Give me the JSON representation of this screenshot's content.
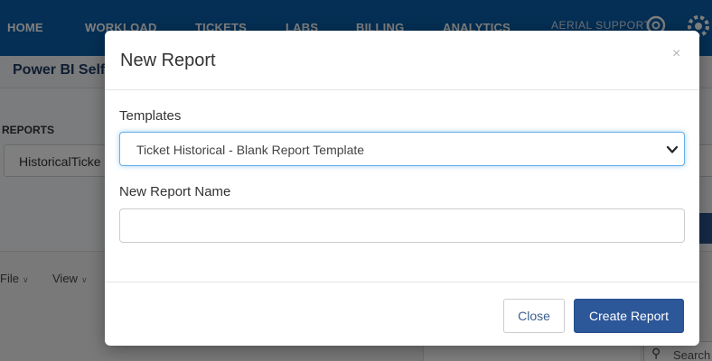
{
  "nav": {
    "items": [
      "HOME",
      "WORKLOAD",
      "TICKETS",
      "LABS",
      "BILLING",
      "ANALYTICS"
    ],
    "brand": "AERIAL SUPPORT"
  },
  "page": {
    "title": "Power BI Self",
    "reports_label": "REPORTS",
    "reports_value": "HistoricalTicke"
  },
  "pbi": {
    "menu": [
      "File",
      "View"
    ],
    "search_label": "Search"
  },
  "modal": {
    "title": "New Report",
    "close_icon": "×",
    "templates_label": "Templates",
    "templates_selected": "Ticket Historical - Blank Report Template",
    "name_label": "New Report Name",
    "name_value": "",
    "close_button": "Close",
    "create_button": "Create Report"
  },
  "colors": {
    "nav_bg": "#0b5fa8",
    "primary_button": "#2c5799",
    "focus_border": "#66afe9"
  }
}
